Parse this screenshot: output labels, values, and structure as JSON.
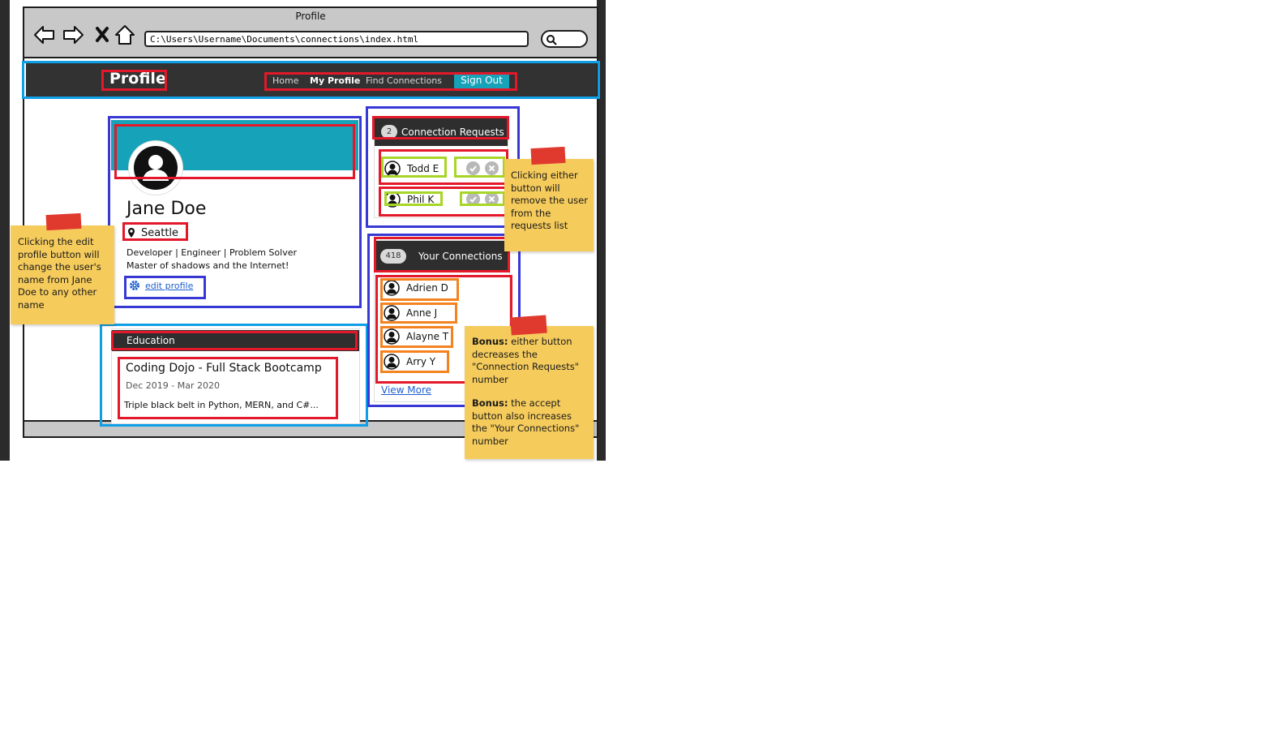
{
  "browser": {
    "title": "Profile",
    "url": "C:\\Users\\Username\\Documents\\connections\\index.html"
  },
  "navbar": {
    "brand": "Profile",
    "links": [
      "Home",
      "My Profile",
      "Find Connections"
    ],
    "sign_out": "Sign Out"
  },
  "profile": {
    "name": "Jane Doe",
    "location": "Seattle",
    "bio_line_1": "Developer | Engineer | Problem Solver",
    "bio_line_2": "Master of shadows and the Internet!",
    "edit_label": "edit profile",
    "cover_color": "#16a2b8"
  },
  "education": {
    "header": "Education",
    "school": "Coding Dojo - Full Stack Bootcamp",
    "dates": "Dec 2019 - Mar 2020",
    "description": "Triple black belt in Python, MERN, and C#..."
  },
  "connection_requests": {
    "count": "2",
    "title": "Connection Requests",
    "people": [
      "Todd E",
      "Phil K"
    ]
  },
  "your_connections": {
    "count": "418",
    "title": "Your Connections",
    "people": [
      "Adrien D",
      "Anne J",
      "Alayne T",
      "Arry Y"
    ],
    "view_more": "View More"
  },
  "notes": {
    "left": "Clicking the edit profile button will change the user's name from Jane Doe to any other name",
    "right_top": "Clicking either button will remove the user from the requests list",
    "bonus_1_label": "Bonus:",
    "bonus_1": "either button decreases the \"Connection Requests\" number",
    "bonus_2_label": "Bonus:",
    "bonus_2": "the accept button also increases the \"Your Connections\" number"
  },
  "icons": {
    "back": "back-arrow-icon",
    "forward": "forward-arrow-icon",
    "stop": "close-x-icon",
    "home": "home-icon",
    "search": "search-icon",
    "user": "user-avatar-icon",
    "location": "map-pin-icon",
    "gear": "gear-icon",
    "accept": "check-icon",
    "decline": "x-circle-icon"
  },
  "colors": {
    "accent": "#16a2b8",
    "navbar": "#323232",
    "annotation_red": "#e3182a",
    "annotation_navy": "#3838d4",
    "annotation_cyan": "#0f9fe6",
    "annotation_lime": "#a7d628",
    "annotation_orange": "#f4831f",
    "sticky_note": "#f5cb5c"
  }
}
